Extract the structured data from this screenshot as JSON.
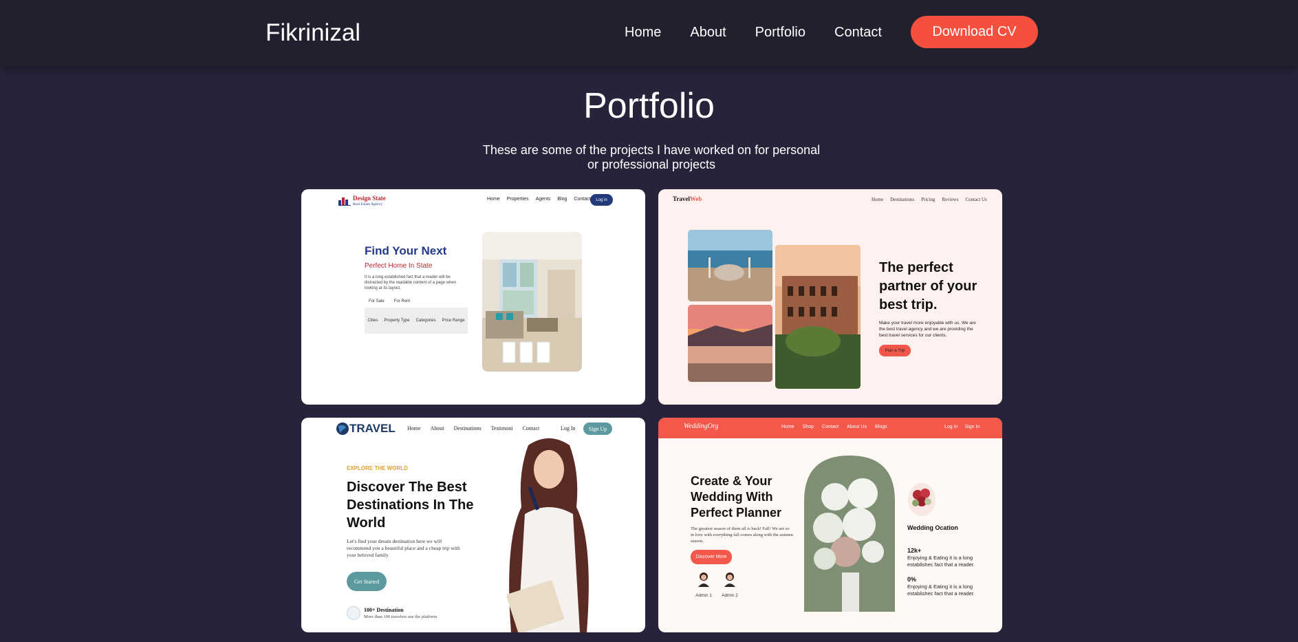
{
  "brand": "Fikrinizal",
  "nav": {
    "links": [
      "Home",
      "About",
      "Portfolio",
      "Contact"
    ],
    "cta": "Download CV"
  },
  "section": {
    "title": "Portfolio",
    "subtitle": "These are some of the projects I have worked on for personal or professional projects"
  },
  "colors": {
    "background": "#27233a",
    "navbar": "#22202f",
    "accent": "#f5503d"
  },
  "projects": [
    {
      "brand": "Design State",
      "brand_sub": "Real Estate Agency",
      "nav": [
        "Home",
        "Properties",
        "Agents",
        "Blog",
        "Contact"
      ],
      "login": "Log in",
      "heading": "Find Your Next",
      "subheading": "Perfect Home In State",
      "text": "It is a long established fact that a reader will be distracted by the readable content of a page when looking at its layout.",
      "tabs": [
        "For Sale",
        "For Rent"
      ],
      "filters": [
        "Cities",
        "Property Type",
        "Categories",
        "Price Range"
      ]
    },
    {
      "brand_a": "Travel",
      "brand_b": "Web",
      "nav": [
        "Home",
        "Destinations",
        "Pricing",
        "Reviews",
        "Contact Us"
      ],
      "heading": "The perfect partner of your best trip.",
      "text": "Make your travel more enjoyable with us. We are the best travel agency and we are providing the best travel services for our clients.",
      "button": "Plan a Trip"
    },
    {
      "brand": "TRAVEL",
      "nav": [
        "Home",
        "About",
        "Destinations",
        "Testimoni",
        "Contact"
      ],
      "login": "Log In",
      "signup": "Sign Up",
      "kicker": "EXPLORE THE WORLD",
      "heading": "Discover The Best Destinations In The World",
      "text": "Let's find your dream destination here we will recommend you a beautiful place and a cheap trip with your beloved family",
      "button": "Get Started",
      "stat_title": "100+ Destination",
      "stat_sub": "More than 100 travelers use the platform"
    },
    {
      "brand": "WeddingOrg",
      "nav": [
        "Home",
        "Shop",
        "Contact",
        "About Us",
        "Blogs"
      ],
      "login": "Log In",
      "signin": "Sign In",
      "heading": "Create & Your Wedding With Perfect Planner",
      "text": "The greatest season of them all is back! Fall! We are so in love with everything fall comes along with the autumn season.",
      "button": "Discover More",
      "admins": [
        "Admin 1",
        "Admin 2"
      ],
      "side_title": "Wedding Ocation",
      "stat1": "12k+",
      "stat1_desc": "Enjoying & Eating it is a long establishec fact that a reader.",
      "stat2": "0%",
      "stat2_desc": "Enjoying & Eating it is a long establishec fact that a reader."
    }
  ]
}
